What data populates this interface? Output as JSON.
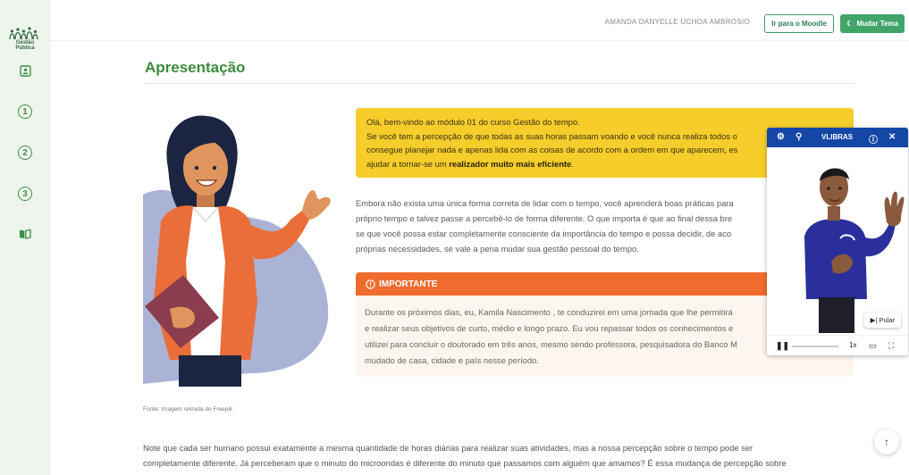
{
  "sidebar": {
    "brand": "Gestão Pública",
    "items": [
      {
        "label": "1"
      },
      {
        "label": "2"
      },
      {
        "label": "3"
      }
    ]
  },
  "header": {
    "username": "AMANDA DANYELLE UCHOA AMBROSIO",
    "moodle_label": "Ir para o Moodle",
    "theme_label": "Mudar Tema"
  },
  "main": {
    "title": "Apresentação",
    "welcome": {
      "line1": "Olá, bem-vindo ao módulo 01 do curso Gestão do tempo.",
      "line2": "Se você tem a percepção de que todas as suas horas passam voando e você nunca realiza todos o",
      "line3": "consegue planejar nada e apenas lida com as coisas de acordo com a ordem em que aparecem, es",
      "line4_pre": "ajudar a tornar-se um ",
      "line4_bold": "realizador muito mais eficiente",
      "line4_post": "."
    },
    "paragraph1": [
      "Embora não exista uma única forma correta de lidar com o tempo, você aprenderá boas práticas para",
      "próprio tempo e talvez passe a percebê-lo de forma diferente. O que importa é que ao final dessa bre",
      "se que você possa estar completamente consciente da importância do tempo e possa decidir, de aco",
      "próprias necessidades, se vale a pena mudar sua gestão pessoal do tempo."
    ],
    "important": {
      "heading": "IMPORTANTE",
      "lines": [
        "Durante os próximos dias, eu, Kamila Nascimento , te conduzirei em uma jornada que lhe permitirá",
        "e realizar seus objetivos de curto, médio e longo prazo. Eu vou repassar todos os conhecimentos e",
        "utilizei para concluir o doutorado em três anos, mesmo sendo professora, pesquisadora do Banco M",
        "mudado de casa, cidade e país nesse período."
      ]
    },
    "caption": "Fonte: Imagem retirada do Freepik",
    "bottom_lines": [
      "Note que cada ser humano possui exatamente a mesma quantidade de horas diárias para realizar suas atividades, mas a nossa percepção sobre o tempo pode ser",
      "completamente diferente. Já perceberam que o minuto do microondas é diferente do minuto que passamos com alguém que amamos? É essa mudança de percepção sobre"
    ]
  },
  "vlibras": {
    "title": "VLIBRAS",
    "skip_label": "Pular",
    "speed": "1x"
  },
  "colors": {
    "accent_green": "#3d8a3d",
    "button_green": "#41a56a",
    "callout_yellow": "#f6cd2b",
    "important_orange": "#ef6b2e",
    "vlibras_blue": "#1447a6"
  }
}
